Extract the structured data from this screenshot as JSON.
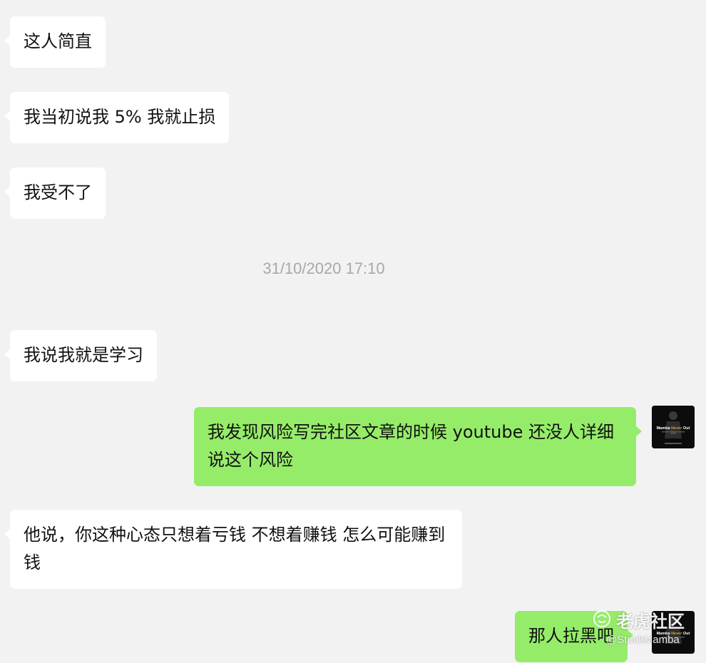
{
  "messages": [
    {
      "sender": "other",
      "text": "这人简直"
    },
    {
      "sender": "other",
      "text": "我当初说我 5% 我就止损"
    },
    {
      "sender": "other",
      "text": "我受不了"
    },
    {
      "sender": "other",
      "text": "我说我就是学习"
    },
    {
      "sender": "me",
      "text": "我发现风险写完社区文章的时候 youtube 还没人详细说这个风险"
    },
    {
      "sender": "other",
      "text": "他说，你这种心态只想着亏钱 不想着赚钱 怎么可能赚到钱"
    },
    {
      "sender": "me",
      "text": "那人拉黑吧"
    }
  ],
  "timestamp": "31/10/2020 17:10",
  "avatar": {
    "line1": "Mamba",
    "line2": "Never",
    "line3": "Out",
    "number": "24"
  },
  "watermark": {
    "brand": "老虎社区",
    "handle": "@StockMamba",
    "icon": "tiger-logo-icon"
  },
  "colors": {
    "background": "#f2f2f2",
    "incoming_bubble": "#ffffff",
    "outgoing_bubble": "#95ec69",
    "timestamp_text": "#a8a8a8"
  }
}
